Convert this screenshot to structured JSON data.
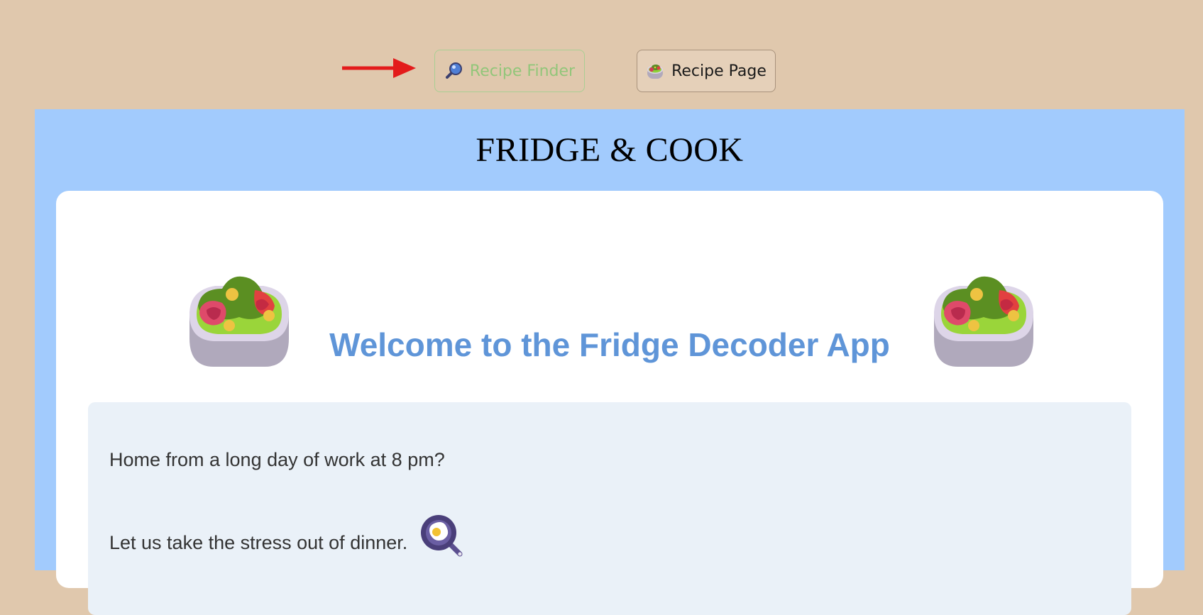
{
  "nav": {
    "finder_label": "Recipe Finder",
    "finder_icon": "magnifier-icon",
    "recipe_label": "Recipe Page",
    "recipe_icon": "salad-bowl-icon",
    "pointer_icon": "red-arrow-icon",
    "active_color": "#92c67a"
  },
  "app": {
    "title": "FRIDGE & COOK",
    "background_color": "#a2cbfd",
    "card": {
      "heading": "Welcome to the Fridge Decoder App",
      "heading_color": "#5f95d8",
      "decor_icon": "salad-bowl-icon",
      "lines": [
        "Home from a long day of work at 8 pm?",
        "Let us take the stress out of dinner."
      ],
      "pan_icon": "frying-pan-egg-icon"
    }
  }
}
